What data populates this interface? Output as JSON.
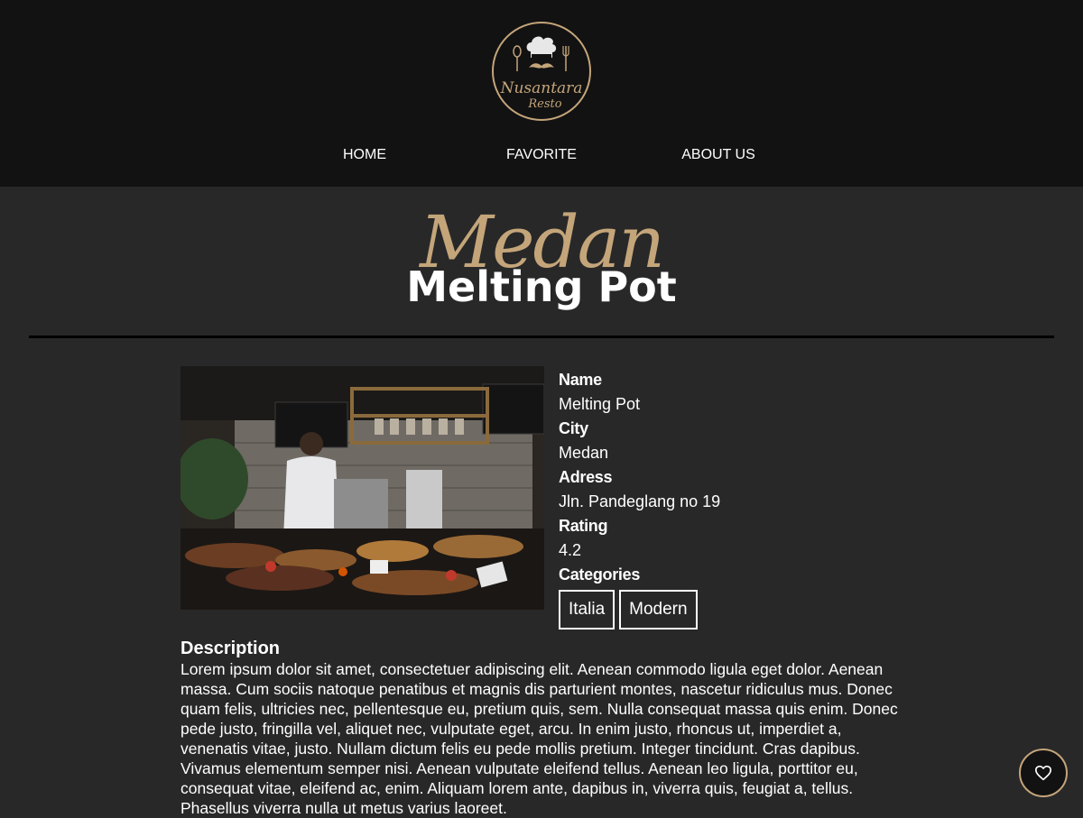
{
  "brand": {
    "logo_text_line1": "Nusantara",
    "logo_text_line2": "Resto",
    "accent_color": "#c4a57a"
  },
  "nav": {
    "items": [
      {
        "label": "HOME"
      },
      {
        "label": "FAVORITE"
      },
      {
        "label": "ABOUT US"
      }
    ]
  },
  "restaurant": {
    "city_script": "Medan",
    "title": "Melting Pot",
    "photo_alt": "restaurant kitchen photo",
    "fields": {
      "name_label": "Name",
      "name_value": "Melting Pot",
      "city_label": "City",
      "city_value": "Medan",
      "address_label": "Adress",
      "address_value": "Jln. Pandeglang no 19",
      "rating_label": "Rating",
      "rating_value": "4.2",
      "categories_label": "Categories"
    },
    "categories": [
      "Italia",
      "Modern"
    ],
    "description_label": "Description",
    "description": "Lorem ipsum dolor sit amet, consectetuer adipiscing elit. Aenean commodo ligula eget dolor. Aenean massa. Cum sociis natoque penatibus et magnis dis parturient montes, nascetur ridiculus mus. Donec quam felis, ultricies nec, pellentesque eu, pretium quis, sem. Nulla consequat massa quis enim. Donec pede justo, fringilla vel, aliquet nec, vulputate eget, arcu. In enim justo, rhoncus ut, imperdiet a, venenatis vitae, justo. Nullam dictum felis eu pede mollis pretium. Integer tincidunt. Cras dapibus. Vivamus elementum semper nisi. Aenean vulputate eleifend tellus. Aenean leo ligula, porttitor eu, consequat vitae, eleifend ac, enim. Aliquam lorem ante, dapibus in, viverra quis, feugiat a, tellus. Phasellus viverra nulla ut metus varius laoreet."
  },
  "favorite_button": {
    "icon": "heart-icon"
  }
}
